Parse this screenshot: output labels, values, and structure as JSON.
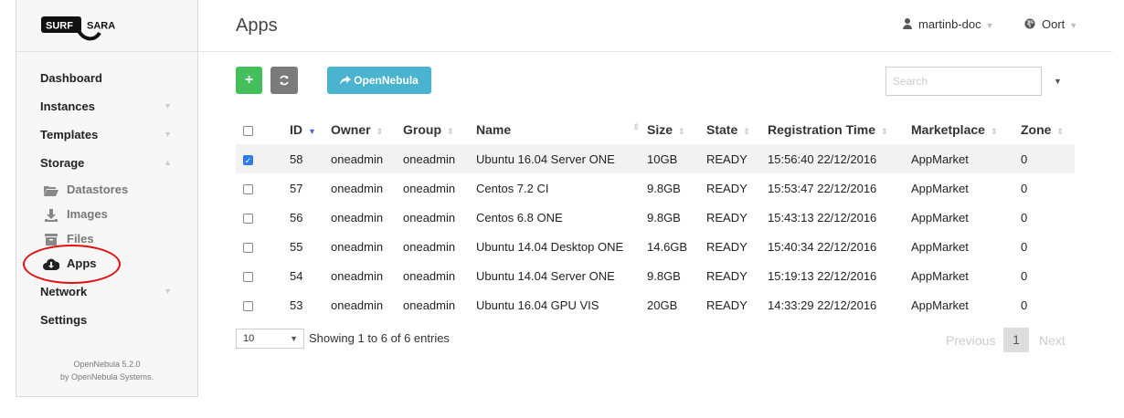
{
  "brand": {
    "logo_left": "SURF",
    "logo_right": "SARA"
  },
  "sidebar": {
    "items": [
      {
        "label": "Dashboard"
      },
      {
        "label": "Instances"
      },
      {
        "label": "Templates"
      },
      {
        "label": "Storage"
      },
      {
        "label": "Datastores"
      },
      {
        "label": "Images"
      },
      {
        "label": "Files"
      },
      {
        "label": "Apps"
      },
      {
        "label": "Network"
      },
      {
        "label": "Settings"
      }
    ],
    "footer_line1": "OpenNebula 5.2.0",
    "footer_line2": "by OpenNebula Systems."
  },
  "header": {
    "title": "Apps",
    "user": "martinb-doc",
    "zone": "Oort"
  },
  "toolbar": {
    "add": "+",
    "refresh": "⟳",
    "opennebula": "OpenNebula",
    "search_placeholder": "Search"
  },
  "table": {
    "columns": [
      "ID",
      "Owner",
      "Group",
      "Name",
      "Size",
      "State",
      "Registration Time",
      "Marketplace",
      "Zone"
    ],
    "rows": [
      [
        "58",
        "oneadmin",
        "oneadmin",
        "Ubuntu 16.04 Server ONE",
        "10GB",
        "READY",
        "15:56:40 22/12/2016",
        "AppMarket",
        "0"
      ],
      [
        "57",
        "oneadmin",
        "oneadmin",
        "Centos 7.2 CI",
        "9.8GB",
        "READY",
        "15:53:47 22/12/2016",
        "AppMarket",
        "0"
      ],
      [
        "56",
        "oneadmin",
        "oneadmin",
        "Centos 6.8 ONE",
        "9.8GB",
        "READY",
        "15:43:13 22/12/2016",
        "AppMarket",
        "0"
      ],
      [
        "55",
        "oneadmin",
        "oneadmin",
        "Ubuntu 14.04 Desktop ONE",
        "14.6GB",
        "READY",
        "15:40:34 22/12/2016",
        "AppMarket",
        "0"
      ],
      [
        "54",
        "oneadmin",
        "oneadmin",
        "Ubuntu 14.04 Server ONE",
        "9.8GB",
        "READY",
        "15:19:13 22/12/2016",
        "AppMarket",
        "0"
      ],
      [
        "53",
        "oneadmin",
        "oneadmin",
        "Ubuntu 16.04 GPU VIS",
        "20GB",
        "READY",
        "14:33:29 22/12/2016",
        "AppMarket",
        "0"
      ]
    ]
  },
  "pagination": {
    "page_size": "10",
    "showing": "Showing 1 to 6 of 6 entries",
    "previous": "Previous",
    "page": "1",
    "next": "Next"
  }
}
